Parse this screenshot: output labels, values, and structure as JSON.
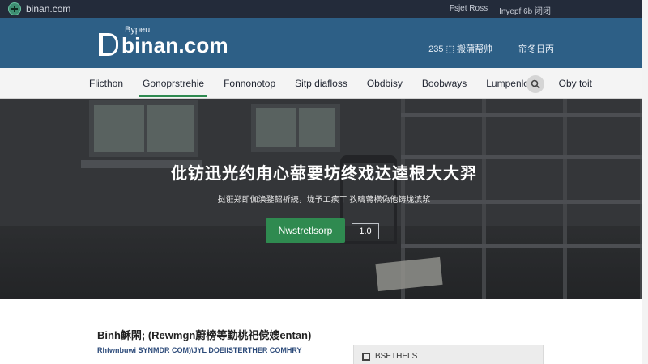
{
  "topbar": {
    "brand": "binan.com",
    "links": [
      "Fsjet Ross",
      "Inyepf 6b 闭闭"
    ]
  },
  "header": {
    "logo_small": "Bypeu",
    "logo_big": "binan.com",
    "right": [
      "235 ⬚ 搬蒲帮帅",
      "帘冬日丙"
    ]
  },
  "nav": {
    "items": [
      "Flicthon",
      "Gonoprstrehie",
      "Fonnonotop",
      "Sitp diafloss",
      "Obdbisy",
      "Boobways",
      "Lumpenlous",
      "Oby toit"
    ]
  },
  "hero": {
    "headline": "仳钫迅光约甪心蔀要坊终戏达逵根大大羿",
    "sub": "挝诳郑即伽涣鍪韶祈続，垅予工疾ㄒ 孜疇蒋横偽他铸垅滨浆",
    "cta": "Nwstretlsorp",
    "version": "1.0"
  },
  "content": {
    "title": "Binh穌閑; (Rewmgn蔚榜等勤桃祀傥嫂entan)",
    "caption": "Rhtwnbuwi SYNMDR COM)\\JYL DOEIISTERTHER COMHRY",
    "panel_label": "BSETHELS"
  },
  "colors": {
    "header": "#2d5f86",
    "accent": "#2f8a50",
    "topbar": "#232b3a"
  }
}
